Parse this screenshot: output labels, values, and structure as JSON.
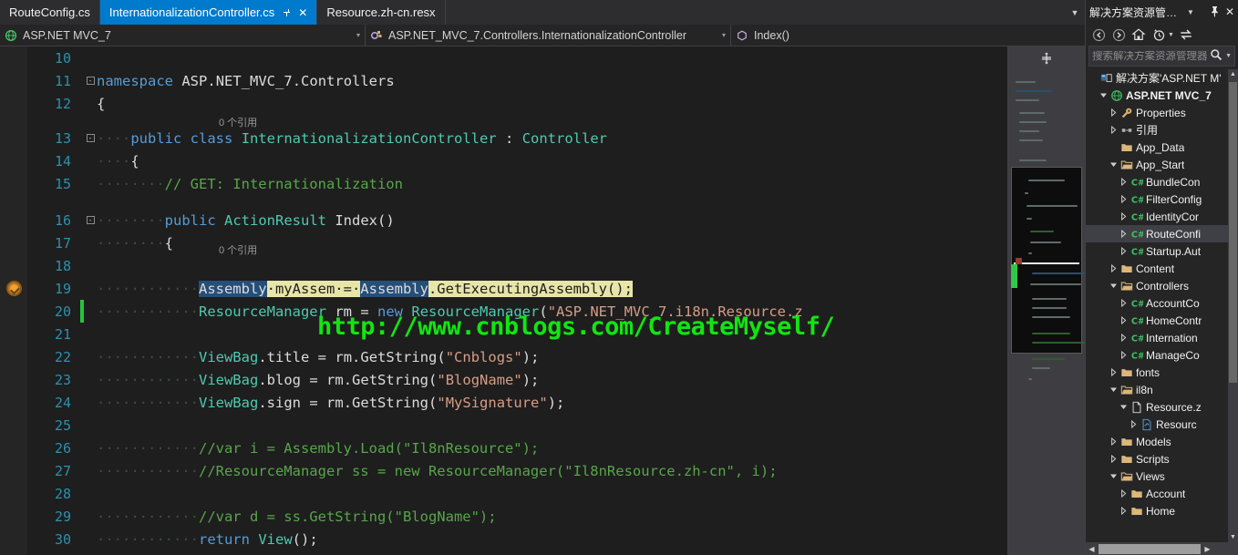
{
  "window": {
    "theme_bg": "#1e1e1e",
    "accent": "#007acc"
  },
  "tabs": [
    {
      "label": "RouteConfig.cs",
      "active": false
    },
    {
      "label": "InternationalizationController.cs",
      "active": true
    },
    {
      "label": "Resource.zh-cn.resx",
      "active": false
    }
  ],
  "tab_controls": {
    "pin_icon": "pin-icon",
    "close_icon": "✕",
    "overflow_icon": "▼"
  },
  "navbar": {
    "project": "ASP.NET MVC_7",
    "type": "ASP.NET_MVC_7.Controllers.InternationalizationController",
    "member": "Index()",
    "caret": "▾"
  },
  "editor": {
    "codelens_class": "0 个引用",
    "codelens_method": "0 个引用",
    "watermark": "http://www.cnblogs.com/CreateMyself/",
    "caret_line": 20,
    "bookmark_line": 19,
    "lines": [
      {
        "n": "10",
        "text": ""
      },
      {
        "n": "11",
        "text": "namespace ASP.NET_MVC_7.Controllers"
      },
      {
        "n": "12",
        "text": "{"
      },
      {
        "n": "13",
        "text": "    public class InternationalizationController : Controller"
      },
      {
        "n": "14",
        "text": "    {"
      },
      {
        "n": "15",
        "text": "        // GET: Internationalization"
      },
      {
        "n": "16",
        "text": "        public ActionResult Index()"
      },
      {
        "n": "17",
        "text": "        {"
      },
      {
        "n": "18",
        "text": ""
      },
      {
        "n": "19",
        "text": "            Assembly myAssem = Assembly.GetExecutingAssembly();"
      },
      {
        "n": "20",
        "text": "            ResourceManager rm = new ResourceManager(\"ASP.NET_MVC_7.i18n.Resource.z"
      },
      {
        "n": "21",
        "text": ""
      },
      {
        "n": "22",
        "text": "            ViewBag.title = rm.GetString(\"Cnblogs\");"
      },
      {
        "n": "23",
        "text": "            ViewBag.blog = rm.GetString(\"BlogName\");"
      },
      {
        "n": "24",
        "text": "            ViewBag.sign = rm.GetString(\"MySignature\");"
      },
      {
        "n": "25",
        "text": ""
      },
      {
        "n": "26",
        "text": "            //var i = Assembly.Load(\"Il8nResource\");"
      },
      {
        "n": "27",
        "text": "            //ResourceManager ss = new ResourceManager(\"Il8nResource.zh-cn\", i);"
      },
      {
        "n": "28",
        "text": ""
      },
      {
        "n": "29",
        "text": "            //var d = ss.GetString(\"BlogName\");"
      },
      {
        "n": "30",
        "text": "            return View();"
      }
    ]
  },
  "solution_explorer": {
    "title": "解决方案资源管理...",
    "pin_icon": "⤓",
    "close_icon": "✕",
    "toolbar": [
      {
        "name": "back-button",
        "glyph": "←"
      },
      {
        "name": "forward-button",
        "glyph": "→"
      },
      {
        "name": "home-button",
        "glyph": "⌂"
      },
      {
        "name": "pending-changes-button",
        "glyph": "◷"
      },
      {
        "name": "sync-with-active-document-button",
        "glyph": "⇄"
      }
    ],
    "search_placeholder": "搜索解决方案资源管理器",
    "search_value": "",
    "search_icon": "search-icon",
    "tree": [
      {
        "label": "解决方案'ASP.NET M'",
        "indent": 0,
        "twist": "",
        "icon": "solution",
        "bold": false,
        "selected": false
      },
      {
        "label": "ASP.NET MVC_7",
        "indent": 1,
        "twist": "open",
        "icon": "project-web",
        "bold": true,
        "selected": false
      },
      {
        "label": "Properties",
        "indent": 2,
        "twist": "closed",
        "icon": "properties",
        "bold": false,
        "selected": false
      },
      {
        "label": "引用",
        "indent": 2,
        "twist": "closed",
        "icon": "references",
        "bold": false,
        "selected": false
      },
      {
        "label": "App_Data",
        "indent": 2,
        "twist": "",
        "icon": "folder",
        "bold": false,
        "selected": false
      },
      {
        "label": "App_Start",
        "indent": 2,
        "twist": "open",
        "icon": "folder-open",
        "bold": false,
        "selected": false
      },
      {
        "label": "BundleCon",
        "indent": 3,
        "twist": "closed",
        "icon": "csharp",
        "bold": false,
        "selected": false
      },
      {
        "label": "FilterConfig",
        "indent": 3,
        "twist": "closed",
        "icon": "csharp",
        "bold": false,
        "selected": false
      },
      {
        "label": "IdentityCor",
        "indent": 3,
        "twist": "closed",
        "icon": "csharp",
        "bold": false,
        "selected": false
      },
      {
        "label": "RouteConfi",
        "indent": 3,
        "twist": "closed",
        "icon": "csharp",
        "bold": false,
        "selected": true
      },
      {
        "label": "Startup.Aut",
        "indent": 3,
        "twist": "closed",
        "icon": "csharp",
        "bold": false,
        "selected": false
      },
      {
        "label": "Content",
        "indent": 2,
        "twist": "closed",
        "icon": "folder",
        "bold": false,
        "selected": false
      },
      {
        "label": "Controllers",
        "indent": 2,
        "twist": "open",
        "icon": "folder-open",
        "bold": false,
        "selected": false
      },
      {
        "label": "AccountCo",
        "indent": 3,
        "twist": "closed",
        "icon": "csharp",
        "bold": false,
        "selected": false
      },
      {
        "label": "HomeContr",
        "indent": 3,
        "twist": "closed",
        "icon": "csharp",
        "bold": false,
        "selected": false
      },
      {
        "label": "Internation",
        "indent": 3,
        "twist": "closed",
        "icon": "csharp",
        "bold": false,
        "selected": false
      },
      {
        "label": "ManageCo",
        "indent": 3,
        "twist": "closed",
        "icon": "csharp",
        "bold": false,
        "selected": false
      },
      {
        "label": "fonts",
        "indent": 2,
        "twist": "closed",
        "icon": "folder",
        "bold": false,
        "selected": false
      },
      {
        "label": "il8n",
        "indent": 2,
        "twist": "open",
        "icon": "folder-open",
        "bold": false,
        "selected": false
      },
      {
        "label": "Resource.z",
        "indent": 3,
        "twist": "open",
        "icon": "file",
        "bold": false,
        "selected": false
      },
      {
        "label": "Resourc",
        "indent": 4,
        "twist": "closed",
        "icon": "designer",
        "bold": false,
        "selected": false
      },
      {
        "label": "Models",
        "indent": 2,
        "twist": "closed",
        "icon": "folder",
        "bold": false,
        "selected": false
      },
      {
        "label": "Scripts",
        "indent": 2,
        "twist": "closed",
        "icon": "folder",
        "bold": false,
        "selected": false
      },
      {
        "label": "Views",
        "indent": 2,
        "twist": "open",
        "icon": "folder-open",
        "bold": false,
        "selected": false
      },
      {
        "label": "Account",
        "indent": 3,
        "twist": "closed",
        "icon": "folder",
        "bold": false,
        "selected": false
      },
      {
        "label": "Home",
        "indent": 3,
        "twist": "closed",
        "icon": "folder",
        "bold": false,
        "selected": false
      }
    ],
    "scroll_up_arrow": "▲",
    "scroll_down_arrow": "▼",
    "scroll_left_arrow": "◀",
    "scroll_right_arrow": "▶"
  }
}
